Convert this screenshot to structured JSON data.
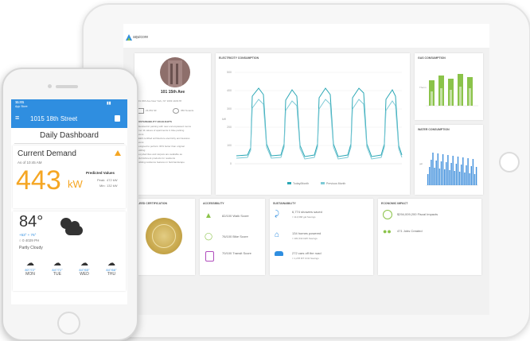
{
  "tablet": {
    "logo": "aquicore",
    "building": {
      "name": "101 15th Ave",
      "address": "101 15th Ave New York, NY 1003 14/0178",
      "sqft": "23,651 SF",
      "tenants": "350 Tenants"
    },
    "sustainability": {
      "title": "SUSTAINABILITY HIGHLIGHTS",
      "lines": [
        "Bike/electric parking with new encompassed rooms",
        "Over 11 values of apartments in bike parking",
        "rooms",
        "LEED certified architecture electricity and features",
        "rooms",
        "Designed to perform 30% better than original",
        "building",
        "Recycled tiles and carpets are available as",
        "refurbishment products for residents",
        "Building resilience features in field landscape"
      ]
    },
    "electricity": {
      "title": "ELECTRICITY CONSUMPTION",
      "ylabel": "kW",
      "ticks": [
        "500",
        "400",
        "300",
        "200",
        "100",
        "0"
      ],
      "legend": [
        "Today/Month",
        "Previous Month"
      ]
    },
    "gas": {
      "title": "GAS CONSUMPTION",
      "ylabel": "Therm"
    },
    "water": {
      "title": "WATER CONSUMPTION",
      "ylabel": "gal"
    },
    "leed": {
      "title": "LEED CERTIFICATION"
    },
    "accessibility": {
      "title": "ACCESSIBILITY",
      "items": [
        {
          "icon": "shoe-icon",
          "text": "82/100 Walk Score"
        },
        {
          "icon": "bike-icon",
          "text": "76/100 Bike Score"
        },
        {
          "icon": "train-icon",
          "text": "70/100 Transit Score"
        }
      ]
    },
    "sust_metrics": {
      "title": "SUSTAINABILITY",
      "items": [
        {
          "main": "6,774 showers saved",
          "sub": "= 113,668 gal Savings"
        },
        {
          "main": "134 homes powered",
          "sub": "= 181,532 kWh Savings"
        },
        {
          "main": "272 cars off the road",
          "sub": "= 1,278 MT CO2 Savings"
        }
      ]
    },
    "economic": {
      "title": "ECONOMIC IMPACT",
      "items": [
        "$294,009,200 Fiscal Impacts",
        "471 Jobs Created"
      ]
    }
  },
  "phone": {
    "time": "11:01",
    "carrier": "App Store",
    "address": "1015 18th Street",
    "dashboard_title": "Daily Dashboard",
    "demand": {
      "title": "Current Demand",
      "as_of": "As of 10:45 AM",
      "value": "443",
      "unit": "kW",
      "predicted_title": "Predicted Values",
      "peak_label": "Peak:",
      "peak_value": "472 kW",
      "min_label": "Min:",
      "min_value": "132 kW"
    },
    "weather": {
      "temp": "84°",
      "range": "+53° + 76°",
      "humidity": "○ 0  4029 PH",
      "condition": "Partly Cloudy",
      "forecast": [
        {
          "temps": "80°/72°",
          "day": "MON"
        },
        {
          "temps": "84°/71°",
          "day": "TUE"
        },
        {
          "temps": "84°/65°",
          "day": "WED"
        },
        {
          "temps": "84°/66°",
          "day": "THU"
        }
      ]
    }
  },
  "colors": {
    "accent": "#2f8ee0",
    "orange": "#f5a623",
    "green": "#8bc34a",
    "teal": "#5ab4c8"
  }
}
